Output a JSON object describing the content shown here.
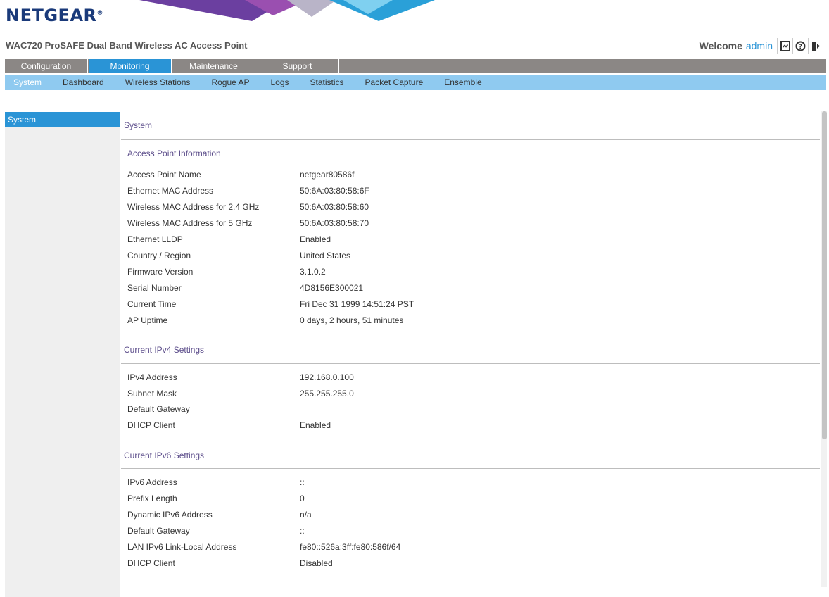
{
  "brand": {
    "logo_text": "NETGEAR"
  },
  "device_title": "WAC720 ProSAFE Dual Band Wireless AC Access Point",
  "welcome": {
    "label": "Welcome",
    "user": "admin",
    "icons": [
      "logout-doc-icon",
      "help-icon",
      "exit-icon"
    ]
  },
  "main_nav": {
    "tabs": [
      "Configuration",
      "Monitoring",
      "Maintenance",
      "Support"
    ],
    "active": "Monitoring"
  },
  "sub_nav": {
    "items": [
      "System",
      "Dashboard",
      "Wireless Stations",
      "Rogue AP",
      "Logs",
      "Statistics",
      "Packet Capture",
      "Ensemble"
    ],
    "active": "System"
  },
  "sidebar": {
    "items": [
      "System"
    ]
  },
  "content": {
    "title": "System",
    "sections": [
      {
        "heading": "Access Point Information",
        "rows": [
          {
            "label": "Access Point Name",
            "value": "netgear80586f"
          },
          {
            "label": "Ethernet MAC Address",
            "value": "50:6A:03:80:58:6F"
          },
          {
            "label": "Wireless MAC Address for 2.4 GHz",
            "value": "50:6A:03:80:58:60"
          },
          {
            "label": "Wireless MAC Address for 5 GHz",
            "value": "50:6A:03:80:58:70"
          },
          {
            "label": "Ethernet LLDP",
            "value": "Enabled"
          },
          {
            "label": "Country / Region",
            "value": "United States"
          },
          {
            "label": "Firmware Version",
            "value": "3.1.0.2"
          },
          {
            "label": "Serial Number",
            "value": "4D8156E300021"
          },
          {
            "label": "Current Time",
            "value": "Fri Dec 31 1999 14:51:24 PST"
          },
          {
            "label": "AP Uptime",
            "value": "0 days, 2 hours, 51 minutes"
          }
        ]
      },
      {
        "heading": "Current IPv4 Settings",
        "rows": [
          {
            "label": "IPv4 Address",
            "value": "192.168.0.100"
          },
          {
            "label": "Subnet Mask",
            "value": "255.255.255.0"
          },
          {
            "label": "Default Gateway",
            "value": ""
          },
          {
            "label": "DHCP Client",
            "value": "Enabled"
          }
        ]
      },
      {
        "heading": "Current IPv6 Settings",
        "rows": [
          {
            "label": "IPv6 Address",
            "value": "::"
          },
          {
            "label": "Prefix Length",
            "value": "0"
          },
          {
            "label": "Dynamic IPv6 Address",
            "value": "n/a"
          },
          {
            "label": "Default Gateway",
            "value": "::"
          },
          {
            "label": "LAN IPv6 Link-Local Address",
            "value": "fe80::526a:3ff:fe80:586f/64"
          },
          {
            "label": "DHCP Client",
            "value": "Disabled"
          }
        ]
      }
    ]
  },
  "colors": {
    "brand_blue": "#1a3a7a",
    "accent": "#2a94d6",
    "subnav_bg": "#8fcaf0",
    "mainnav_bg": "#8b8785",
    "heading": "#5b4c8a"
  }
}
